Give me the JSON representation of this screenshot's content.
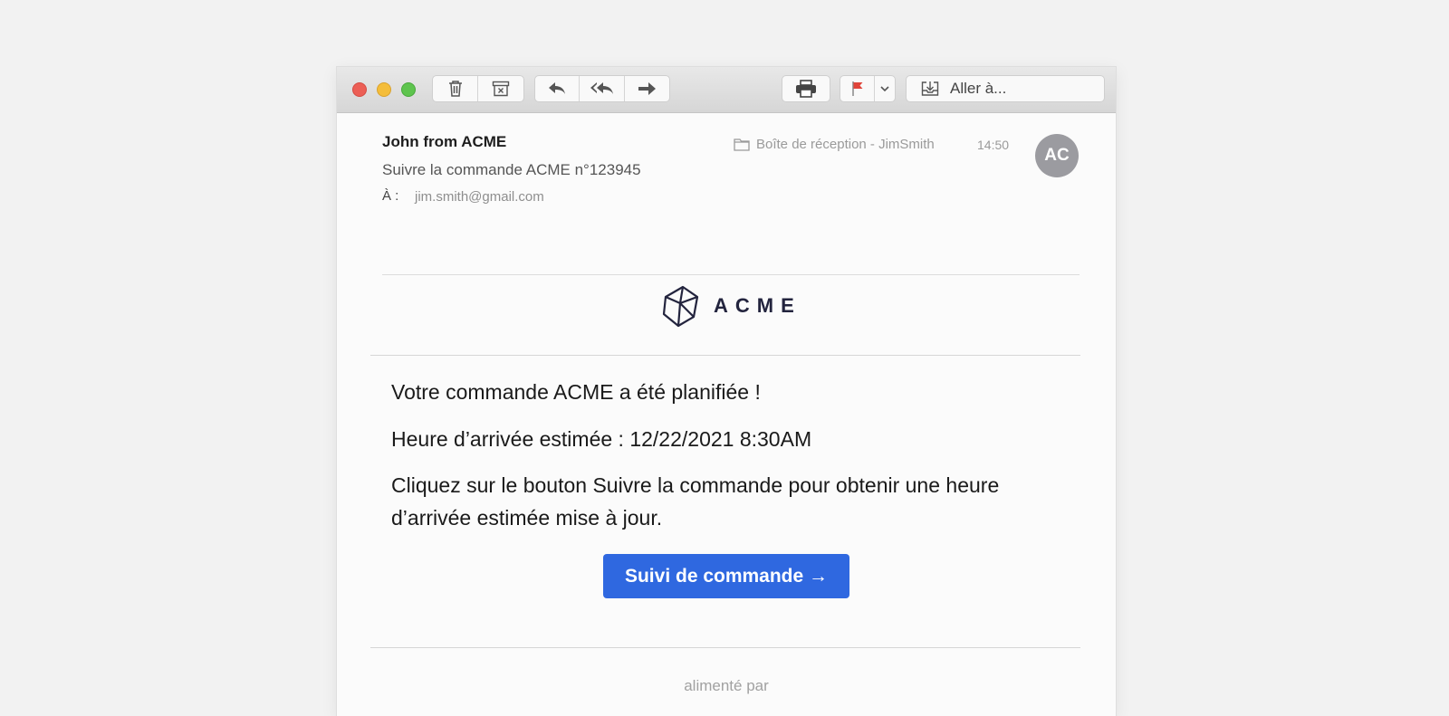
{
  "toolbar": {
    "icons": [
      "trash-icon",
      "archive-icon",
      "reply-icon",
      "reply-all-icon",
      "forward-icon",
      "print-icon",
      "flag-icon",
      "chevron-down-icon",
      "move-to-icon"
    ],
    "goto_label": "Aller à...",
    "flag_color": "#e0443a"
  },
  "message": {
    "sender": "John from ACME",
    "subject": "Suivre la commande ACME n°123945",
    "to_label": "À :",
    "to_address": "jim.smith@gmail.com",
    "mailbox": "Boîte de réception - JimSmith",
    "time": "14:50",
    "avatar_initials": "AC"
  },
  "email_body": {
    "brand": "ACME",
    "headline": "Votre commande ACME a été planifiée !",
    "eta": "Heure d’arrivée estimée : 12/22/2021 8:30AM",
    "instructions": "Cliquez sur le bouton Suivre la commande pour obtenir une heure d’arrivée estimée mise à jour.",
    "cta_label": "Suivi de commande →",
    "cta_color": "#2f68e0",
    "footer": "alimenté par"
  }
}
